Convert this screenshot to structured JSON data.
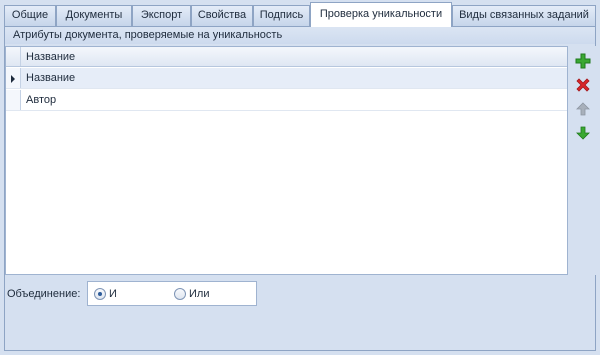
{
  "tabs": [
    {
      "label": "Общие"
    },
    {
      "label": "Документы"
    },
    {
      "label": "Экспорт"
    },
    {
      "label": "Свойства"
    },
    {
      "label": "Подпись"
    },
    {
      "label": "Проверка уникальности"
    },
    {
      "label": "Виды связанных заданий"
    }
  ],
  "active_tab": "Проверка уникальности",
  "group": {
    "caption": "Атрибуты документа, проверяемые на уникальность"
  },
  "grid": {
    "column_header": "Название",
    "rows": [
      {
        "name": "Название"
      },
      {
        "name": "Автор"
      }
    ],
    "selected_row": 0
  },
  "toolbar": {
    "add_icon": "add-icon",
    "delete_icon": "delete-icon",
    "move_up_icon": "arrow-up-icon",
    "move_down_icon": "arrow-down-icon"
  },
  "union": {
    "label": "Объединение:",
    "options": [
      {
        "label": "И",
        "checked": true
      },
      {
        "label": "Или",
        "checked": false
      }
    ]
  },
  "colors": {
    "background": "#d5e0f0",
    "border": "#8ea4c4",
    "add_green": "#3aa832",
    "delete_red": "#d9262a",
    "disabled_gray": "#a8b0bb"
  }
}
